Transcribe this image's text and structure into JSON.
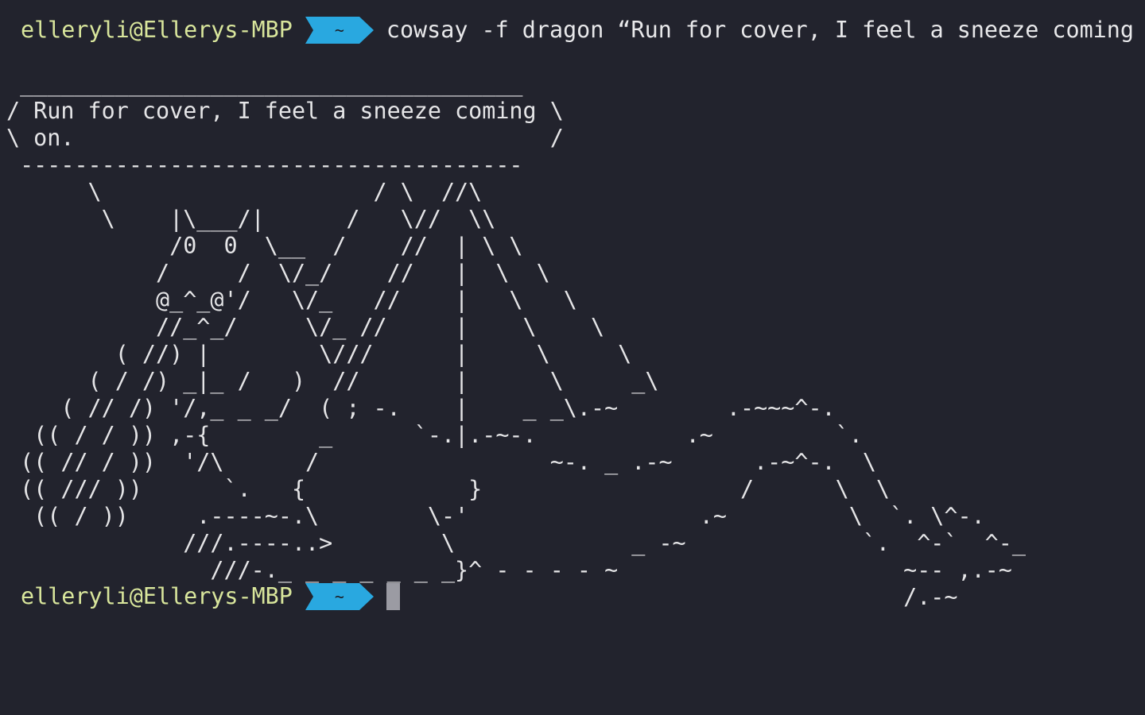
{
  "colors": {
    "background": "#22232d",
    "user_host": "#d9e69c",
    "dir_segment": "#29a8e0",
    "text": "#e5e5e7",
    "cursor": "#9b9ba3"
  },
  "prompt": {
    "user_host": "elleryli@Ellerys-MBP",
    "directory": "~",
    "segment_icon": "powerline-arrow-icon"
  },
  "command": "cowsay -f dragon “Run for cover, I feel a sneeze coming on.”",
  "output_lines": [
    " _____________________________________",
    "/ Run for cover, I feel a sneeze coming \\",
    "\\ on.                                   /",
    " -------------------------------------",
    "      \\                    / \\  //\\",
    "       \\    |\\___/|      /   \\//  \\\\",
    "            /0  0  \\__  /    //  | \\ \\",
    "           /     /  \\/_/    //   |  \\  \\",
    "           @_^_@'/   \\/_   //    |   \\   \\",
    "           //_^_/     \\/_ //     |    \\    \\",
    "        ( //) |        \\///      |     \\     \\",
    "      ( / /) _|_ /   )  //       |      \\     _\\",
    "    ( // /) '/,_ _ _/  ( ; -.    |    _ _\\.-~        .-~~~^-.",
    "  (( / / )) ,-{        _      `-.|.-~-.           .~         `.",
    " (( // / ))  '/\\      /                 ~-. _ .-~      .-~^-.  \\",
    " (( /// ))      `.   {            }                   /      \\  \\",
    "  (( / ))     .----~-.\\        \\-'                 .~         \\  `. \\^-.",
    "             ///.----..>        \\             _ -~             `.  ^-`  ^-_",
    "               ///-._ _ _ _ _ _ _}^ - - - - ~                     ~-- ,.-~",
    "                                                                  /.-~"
  ]
}
